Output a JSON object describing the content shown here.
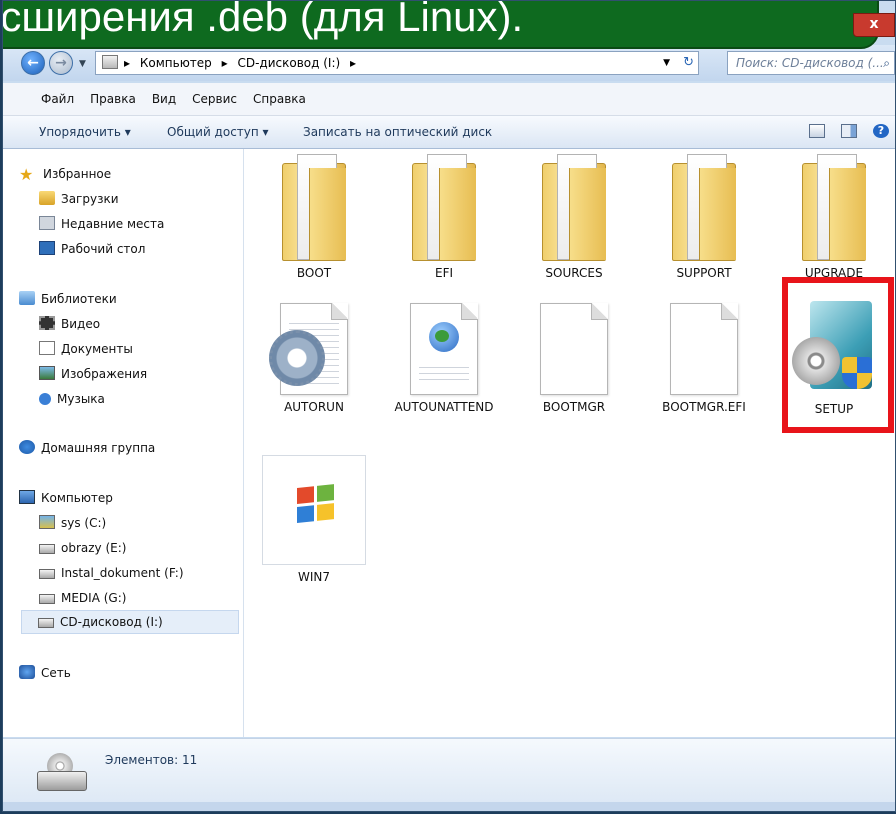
{
  "banner": {
    "text": "асширения .deb (для Linux)."
  },
  "address": {
    "crumbs": [
      "Компьютер",
      "CD-дисковод (I:)"
    ],
    "search_placeholder": "Поиск: CD-дисковод (..."
  },
  "menu": [
    "Файл",
    "Правка",
    "Вид",
    "Сервис",
    "Справка"
  ],
  "commands": {
    "organize": "Упорядочить ▾",
    "share": "Общий доступ ▾",
    "burn": "Записать на оптический диск"
  },
  "nav": {
    "favorites": "Избранное",
    "downloads": "Загрузки",
    "recent": "Недавние места",
    "desktop": "Рабочий стол",
    "libraries": "Библиотеки",
    "video": "Видео",
    "documents": "Документы",
    "images": "Изображения",
    "music": "Музыка",
    "homegroup": "Домашняя группа",
    "computer": "Компьютер",
    "drive_c": "sys (C:)",
    "drive_e": "obrazy (E:)",
    "drive_f": "Instal_dokument (F:)",
    "drive_g": "MEDIA (G:)",
    "drive_i": "CD-дисковод (I:)",
    "network": "Сеть"
  },
  "files": [
    {
      "name": "BOOT",
      "kind": "folder"
    },
    {
      "name": "EFI",
      "kind": "folder"
    },
    {
      "name": "SOURCES",
      "kind": "folder"
    },
    {
      "name": "SUPPORT",
      "kind": "folder"
    },
    {
      "name": "UPGRADE",
      "kind": "folder"
    },
    {
      "name": "AUTORUN",
      "kind": "config-file"
    },
    {
      "name": "AUTOUNATTEND",
      "kind": "xml-file"
    },
    {
      "name": "BOOTMGR",
      "kind": "file"
    },
    {
      "name": "BOOTMGR.EFI",
      "kind": "file"
    },
    {
      "name": "SETUP",
      "kind": "setup-exe",
      "highlighted": true
    },
    {
      "name": "WIN7",
      "kind": "windows-image"
    }
  ],
  "details": {
    "count_text": "Элементов: 11"
  },
  "colors": {
    "highlight": "#e8141a",
    "banner": "#0e6a1f"
  }
}
